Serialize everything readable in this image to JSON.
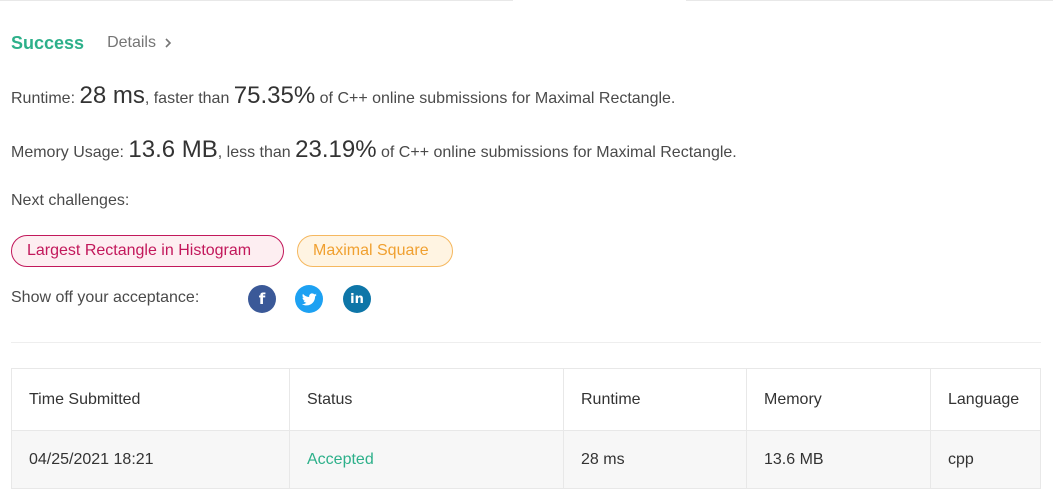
{
  "status": {
    "result": "Success",
    "details_label": "Details"
  },
  "runtime": {
    "label": "Runtime:",
    "value": "28 ms",
    "mid": ", faster than",
    "percent": "75.35%",
    "suffix": "of C++ online submissions for Maximal Rectangle."
  },
  "memory": {
    "label": "Memory Usage:",
    "value": "13.6 MB",
    "mid": ", less than",
    "percent": "23.19%",
    "suffix": "of C++ online submissions for Maximal Rectangle."
  },
  "next_challenges": {
    "label": "Next challenges:",
    "items": [
      {
        "label": "Largest Rectangle in Histogram",
        "color": "#c2185b"
      },
      {
        "label": "Maximal Square",
        "color": "#f0a030"
      }
    ]
  },
  "share": {
    "label": "Show off your acceptance:",
    "icons": [
      "facebook-icon",
      "twitter-icon",
      "linkedin-icon"
    ],
    "colors": {
      "facebook": "#3b5998",
      "twitter": "#1da1f2",
      "linkedin": "#0e76a8"
    },
    "linkedin_text": "in",
    "facebook_text": "f"
  },
  "submissions": {
    "headers": [
      "Time Submitted",
      "Status",
      "Runtime",
      "Memory",
      "Language"
    ],
    "rows": [
      {
        "time": "04/25/2021 18:21",
        "status": "Accepted",
        "runtime": "28 ms",
        "memory": "13.6 MB",
        "language": "cpp"
      }
    ]
  },
  "colors": {
    "accent": "#2db08a"
  }
}
